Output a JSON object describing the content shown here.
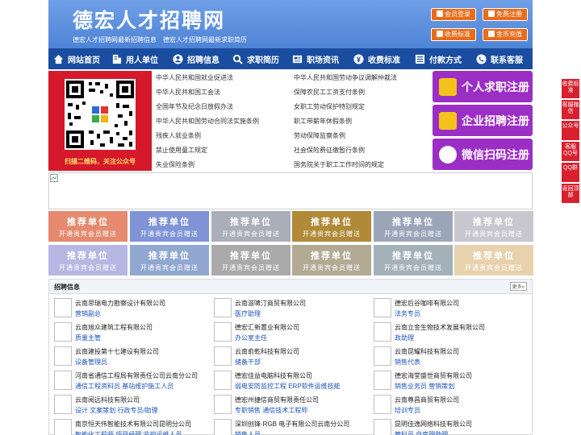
{
  "header": {
    "logo": "德宏人才招聘网",
    "slogan": "德宏人才招聘网最新招聘信息　德宏人才招聘网最新求职简历",
    "buttons": [
      "会员登录",
      "免费注册",
      "收费标准",
      "金币充值"
    ]
  },
  "nav": [
    "网站首页",
    "用人单位",
    "招聘信息",
    "求职简历",
    "职场资讯",
    "收费标准",
    "付款方式",
    "联系客服"
  ],
  "qr_caption": "扫描二维码，关注公众号",
  "links": {
    "left": [
      "中华人民共和国就业促进法",
      "中华人民共和国工会法",
      "全国年节及纪念日放假办法",
      "中华人民共和国劳动合同法实施条例",
      "残疾人就业条例",
      "禁止使用童工规定",
      "失业保险条例"
    ],
    "right": [
      "中华人民共和国劳动争议调解仲裁法",
      "保障农民工工资支付条例",
      "女职工劳动保护特别规定",
      "职工带薪年休假条例",
      "劳动保障监察条例",
      "社会保险费征缴暂行条例",
      "国务院关于职工工作时间的规定"
    ]
  },
  "register": [
    "个人求职注册",
    "企业招聘注册",
    "微信扫码注册"
  ],
  "recommend": {
    "title": "推荐单位",
    "sub": "开通贵宾会员赠送",
    "colors": [
      "#e58a6e",
      "#7f93d6",
      "#a9aeb9",
      "#b08a38",
      "#9aa6b8",
      "#c8c6cf",
      "#b7b7e3",
      "#90a8d0",
      "#aaaaaa",
      "#b3aa94",
      "#a3b2b9",
      "#e8d2ae"
    ]
  },
  "recruit": {
    "title": "招聘信息",
    "more": "更多»",
    "jobs": [
      {
        "company": "云南思瑞电力勘察设计有限公司",
        "positions": "营销副总"
      },
      {
        "company": "云南滋啸汀商贸有限公司",
        "positions": "医疗助理"
      },
      {
        "company": "德宏后谷咖啡有限公司",
        "positions": "法务专员"
      },
      {
        "company": "云南旭众建筑工程有限公司",
        "positions": "质量主管"
      },
      {
        "company": "德宏汇新置业有限公司",
        "positions": "办公室主任"
      },
      {
        "company": "云南立金生物技术发展有限公司",
        "positions": "政助理"
      },
      {
        "company": "云南建投第十七建设有限公司",
        "positions": "设备管理员"
      },
      {
        "company": "云南俞乾科技有限公司",
        "positions": "储备干部"
      },
      {
        "company": "云南昆耀科技有限公司",
        "positions": "销售代表"
      },
      {
        "company": "河南省通信工程局有限责任公司云南分公司",
        "positions": "通信工程资料员  基站维护施工人员"
      },
      {
        "company": "德宏佳益电脑科技有限公司",
        "positions": "弱电安防监控工程 ERP软件运维技能"
      },
      {
        "company": "德宏海堂盛世商贸有限公司",
        "positions": "销售业务员  营销策划"
      },
      {
        "company": "云南阅远科技有限公司",
        "positions": "设计  文案策划  行政专员/助理"
      },
      {
        "company": "德宏州捷信商贸有限责任公司",
        "positions": "专职销售  通信技术工程师"
      },
      {
        "company": "云南尊昌商贸有限公司",
        "positions": "培训专员"
      },
      {
        "company": "南京恒天伟智能技术有限公司昆明分公司",
        "positions": "智能化工程师  项目经理  监控运维人员"
      },
      {
        "company": "深圳创锋·RGB 电子有限公司云南分公司",
        "positions": "销售人员"
      },
      {
        "company": "昆明佳逸网络科技有限公司",
        "positions": "管科员  自库理助理"
      }
    ]
  },
  "side": [
    "收费标准",
    "客服微信",
    "公众号",
    "客服QQ号",
    "QQ群",
    "返回顶部"
  ]
}
